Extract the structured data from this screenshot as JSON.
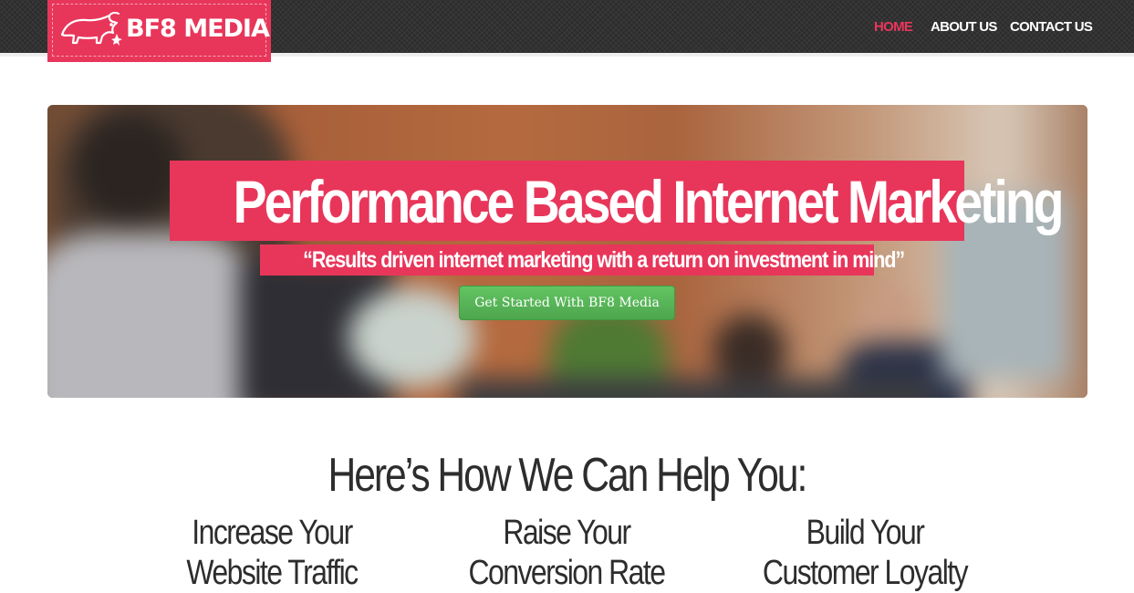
{
  "brand": {
    "name": "BF8 MEDIA",
    "logo_icon": "bull-icon",
    "color": "#e8365a"
  },
  "nav": {
    "items": [
      {
        "label": "HOME",
        "active": true
      },
      {
        "label": "ABOUT US",
        "active": false
      },
      {
        "label": "CONTACT US",
        "active": false
      }
    ],
    "active_color": "#e8365a"
  },
  "hero": {
    "title": "Performance Based Internet Marketing",
    "subtitle": "“Results driven internet marketing with a return on investment in mind”",
    "cta_label": "Get Started With BF8 Media",
    "cta_color": "#5cb85c"
  },
  "services": {
    "heading": "Here’s How We Can Help You:",
    "items": [
      {
        "line1": "Increase Your",
        "line2": "Website Traffic"
      },
      {
        "line1": "Raise Your",
        "line2": "Conversion Rate"
      },
      {
        "line1": "Build Your",
        "line2": "Customer Loyalty"
      }
    ]
  }
}
